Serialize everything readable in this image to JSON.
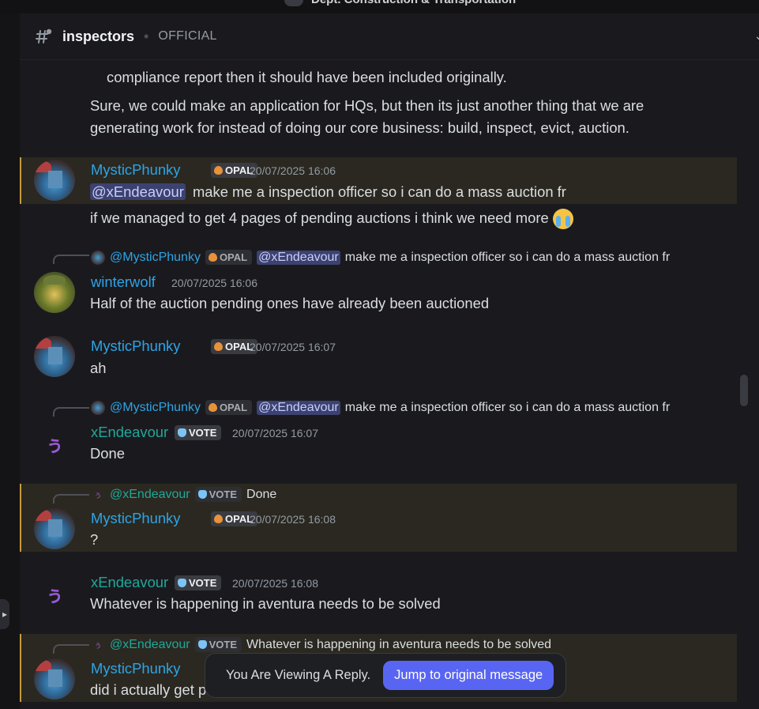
{
  "window": {
    "server_name": "Dept. Construction & Transportation"
  },
  "header": {
    "channel_name": "inspectors",
    "separator": "•",
    "topic": "OFFICIAL"
  },
  "messages": {
    "m0_line1": "compliance report then it should have been included originally.",
    "m0_line2": "Sure, we could make an application for HQs, but then its just another thing that we are",
    "m0_line3": "generating work for instead of doing our core business: build, inspect, evict, auction.",
    "m1": {
      "author": "MysticPhunky",
      "tag": "OPAL",
      "time": "20/07/2025 16:06",
      "mention": "@xEndeavour",
      "text": "make me a inspection officer so i can do a mass auction fr",
      "text2": "if we managed to get 4 pages of pending auctions i think we need more"
    },
    "m2": {
      "reply_author": "@MysticPhunky",
      "reply_tag": "OPAL",
      "reply_mention": "@xEndeavour",
      "reply_text": "make me a inspection officer so i can do a mass auction fr",
      "author": "winterwolf",
      "time": "20/07/2025 16:06",
      "text": "Half of the auction pending ones have already been auctioned"
    },
    "m3": {
      "author": "MysticPhunky",
      "tag": "OPAL",
      "time": "20/07/2025 16:07",
      "text": "ah"
    },
    "m4": {
      "reply_author": "@MysticPhunky",
      "reply_tag": "OPAL",
      "reply_mention": "@xEndeavour",
      "reply_text": "make me a inspection officer so i can do a mass auction fr",
      "author": "xEndeavour",
      "tag": "VOTE",
      "time": "20/07/2025 16:07",
      "text": "Done"
    },
    "m5": {
      "reply_author": "@xEndeavour",
      "reply_tag": "VOTE",
      "reply_text": "Done",
      "author": "MysticPhunky",
      "tag": "OPAL",
      "time": "20/07/2025 16:08",
      "text": "?"
    },
    "m6": {
      "author": "xEndeavour",
      "tag": "VOTE",
      "time": "20/07/2025 16:08",
      "text": "Whatever is happening in aventura needs to be solved"
    },
    "m7": {
      "reply_author": "@xEndeavour",
      "reply_tag": "VOTE",
      "reply_text": "Whatever is happening in aventura needs to be solved",
      "author": "MysticPhunky",
      "text_visible": "did i actually get p"
    }
  },
  "reply_banner": {
    "text": "You Are Viewing A Reply.",
    "button": "Jump to original message"
  },
  "colors": {
    "accent": "#5865f2",
    "highlight_border": "#c99a3c",
    "name_blue": "#2ea4e6",
    "name_teal": "#1fa89b"
  },
  "icons": {
    "channel": "hash-thread-icon",
    "opal": "opal-gem-icon",
    "vote": "vote-gem-icon",
    "emoji": "loudly-crying-face-emoji"
  }
}
